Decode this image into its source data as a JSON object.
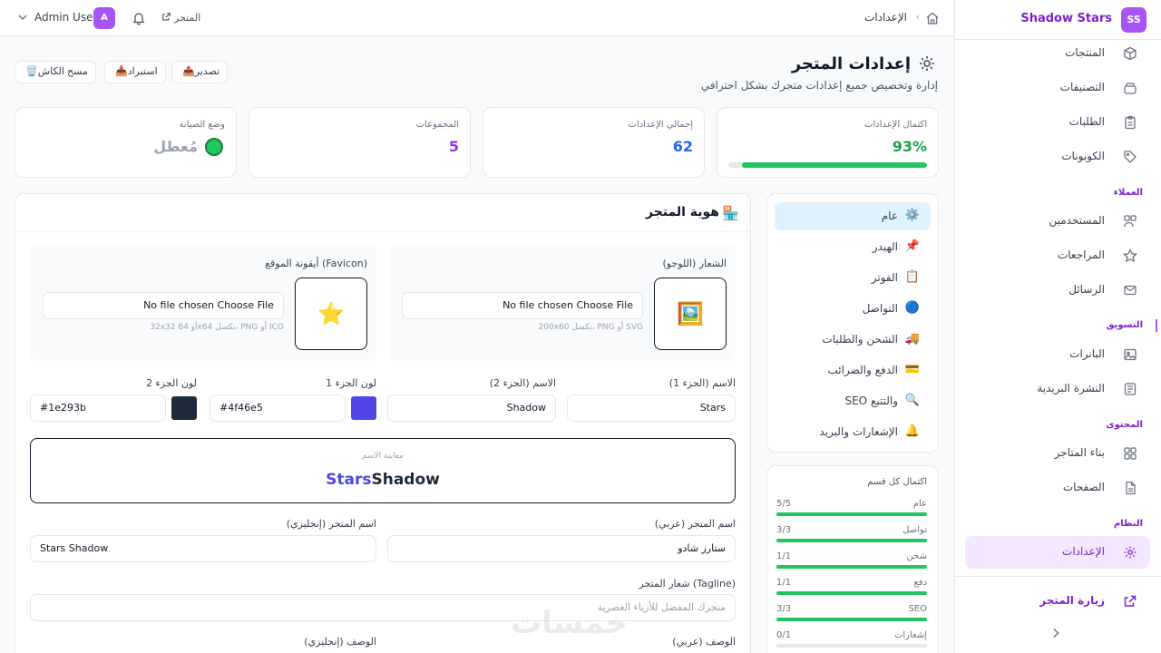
{
  "brand": {
    "logo_text": "SS",
    "name": "Shadow Stars"
  },
  "sidebar": {
    "items": [
      {
        "label": "المنتجات",
        "icon": "box-icon"
      },
      {
        "label": "التصنيفات",
        "icon": "layers-icon"
      },
      {
        "label": "الطلبات",
        "icon": "clipboard-icon"
      },
      {
        "label": "الكوبونات",
        "icon": "tag-icon"
      },
      {
        "label": "المستخدمين",
        "icon": "users-icon"
      },
      {
        "label": "المراجعات",
        "icon": "star-icon"
      },
      {
        "label": "الرسائل",
        "icon": "mail-icon"
      },
      {
        "label": "البانرات",
        "icon": "image-icon"
      },
      {
        "label": "النشرة البريدية",
        "icon": "newspaper-icon"
      },
      {
        "label": "بناء المتاجر",
        "icon": "grid-icon"
      },
      {
        "label": "الصفحات",
        "icon": "file-icon"
      },
      {
        "label": "الإعدادات",
        "icon": "gear-icon"
      }
    ],
    "sections": {
      "customers": "العملاء",
      "marketing": "التسويق",
      "content": "المحتوى",
      "system": "النظام"
    },
    "visit_store": "زيارة المتجر"
  },
  "topbar": {
    "breadcrumb": "الإعدادات",
    "store_link": "المتجر",
    "user_name": "Admin User",
    "user_initial": "A"
  },
  "header": {
    "title": "إعدادات المتجر",
    "subtitle": "إدارة وتخصيص جميع إعدادات متجرك بشكل احترافي",
    "actions": {
      "clear_cache": "مسح الكاش",
      "import": "استيراد",
      "export": "تصدير"
    }
  },
  "stats": {
    "completion": {
      "label": "اكتمال الإعدادات",
      "value": "93%",
      "percent": 93
    },
    "total": {
      "label": "إجمالي الإعدادات",
      "value": "62"
    },
    "groups": {
      "label": "المجموعات",
      "value": "5"
    },
    "maintenance": {
      "label": "وضع الصيانة",
      "value": "مُعطل"
    }
  },
  "nav": {
    "items": [
      {
        "label": "عام",
        "emoji": "⚙️"
      },
      {
        "label": "الهيدر",
        "emoji": "📌"
      },
      {
        "label": "الفوتر",
        "emoji": "📋"
      },
      {
        "label": "التواصل",
        "emoji": "🔵"
      },
      {
        "label": "الشحن والطلبات",
        "emoji": "🚚"
      },
      {
        "label": "الدفع والضرائب",
        "emoji": "💳"
      },
      {
        "label": "SEO والتتبع",
        "emoji": "🔍"
      },
      {
        "label": "الإشعارات والبريد",
        "emoji": "🔔"
      }
    ]
  },
  "progress": {
    "title": "اكتمال كل قسم",
    "rows": [
      {
        "name": "عام",
        "count": "5/5",
        "ratio": 1
      },
      {
        "name": "تواصل",
        "count": "3/3",
        "ratio": 1
      },
      {
        "name": "شحن",
        "count": "1/1",
        "ratio": 1
      },
      {
        "name": "دفع",
        "count": "1/1",
        "ratio": 1
      },
      {
        "name": "SEO",
        "count": "3/3",
        "ratio": 1
      },
      {
        "name": "إشعارات",
        "count": "0/1",
        "ratio": 0
      }
    ]
  },
  "identity": {
    "title": "هوية المتجر",
    "logo": {
      "label": "الشعار (اللوجو)",
      "file_text": "No file chosen Choose File",
      "hint": "200x60 بكسل، PNG أو SVG"
    },
    "favicon": {
      "label": "أيقونة الموقع (Favicon)",
      "file_text": "No file chosen Choose File",
      "hint": "32x32 أو 64x64 بكسل، PNG أو ICO"
    },
    "name_part1": {
      "label": "الاسم (الجزء 1)",
      "value": "Stars"
    },
    "name_part2": {
      "label": "الاسم (الجزء 2)",
      "value": "Shadow"
    },
    "color1": {
      "label": "لون الجزء 1",
      "value": "#4f46e5"
    },
    "color2": {
      "label": "لون الجزء 2",
      "value": "#1e293b"
    },
    "preview": {
      "label": "معاينة الاسم",
      "part1": "Stars",
      "part2": "Shadow"
    },
    "store_name_ar": {
      "label": "اسم المتجر (عربي)",
      "value": "ستارز شادو"
    },
    "store_name_en": {
      "label": "اسم المتجر (إنجليزي)",
      "value": "Stars Shadow"
    },
    "tagline": {
      "label": "شعار المتجر (Tagline)",
      "placeholder": "متجرك المفضل للأزياء العصرية"
    },
    "desc_ar": {
      "label": "الوصف (عربي)"
    },
    "desc_en": {
      "label": "الوصف (إنجليزي)"
    }
  },
  "watermark": "خمسات"
}
